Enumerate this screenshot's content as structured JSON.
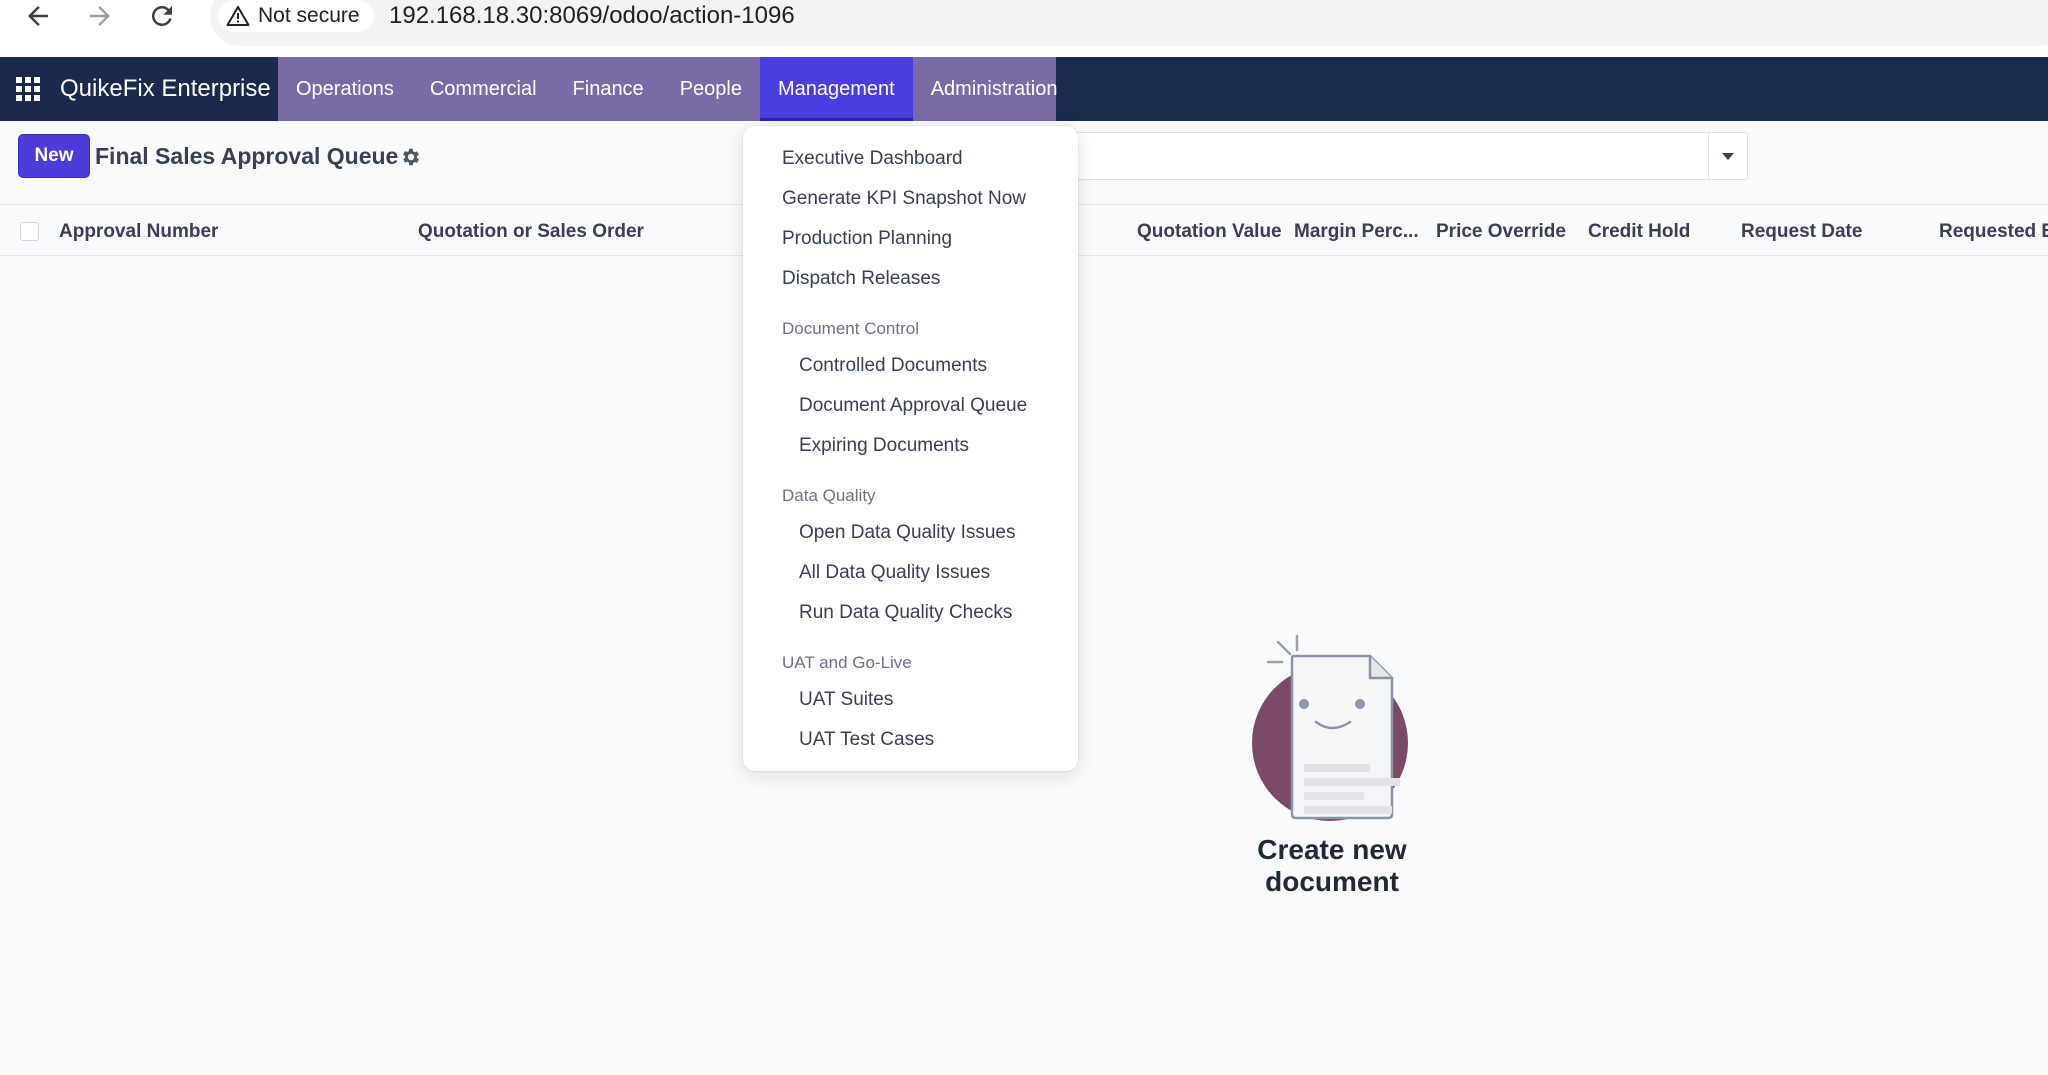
{
  "browser": {
    "security_label": "Not secure",
    "url": "192.168.18.30:8069/odoo/action-1096"
  },
  "navbar": {
    "brand": "QuikeFix Enterprise",
    "menus": [
      {
        "label": "Operations"
      },
      {
        "label": "Commercial"
      },
      {
        "label": "Finance"
      },
      {
        "label": "People"
      },
      {
        "label": "Management"
      },
      {
        "label": "Administration"
      }
    ],
    "active_menu": "Management"
  },
  "control_panel": {
    "new_label": "New",
    "title": "Final Sales Approval Queue"
  },
  "list": {
    "columns": [
      "Approval Number",
      "Quotation or Sales Order",
      "Quotation Value",
      "Margin Perc...",
      "Price Override",
      "Credit Hold",
      "Request Date",
      "Requested B"
    ]
  },
  "empty_state": {
    "title": "Create new document"
  },
  "management_menu": {
    "top_items": [
      "Executive Dashboard",
      "Generate KPI Snapshot Now",
      "Production Planning",
      "Dispatch Releases"
    ],
    "sections": [
      {
        "header": "Document Control",
        "items": [
          "Controlled Documents",
          "Document Approval Queue",
          "Expiring Documents"
        ]
      },
      {
        "header": "Data Quality",
        "items": [
          "Open Data Quality Issues",
          "All Data Quality Issues",
          "Run Data Quality Checks"
        ]
      },
      {
        "header": "UAT and Go-Live",
        "items": [
          "UAT Suites",
          "UAT Test Cases"
        ]
      }
    ]
  },
  "colors": {
    "navbar_bg": "#1a2b4f",
    "menu_bg": "#7b6aa8",
    "active_menu_bg": "#4b3ee0",
    "primary_button": "#4c3bd8",
    "illustration_circle": "#7a4a68"
  }
}
